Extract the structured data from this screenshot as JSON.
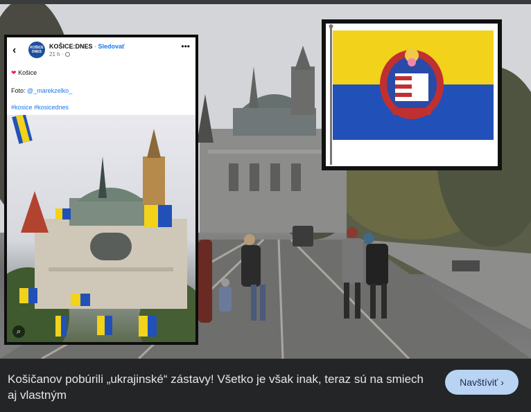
{
  "post": {
    "page_name": "KOŠICE:DNES",
    "separator": "·",
    "follow_label": "Sledovať",
    "time": "21 h ·",
    "avatar_text": "KOŠICE DNES",
    "text_line1": "Košice",
    "text_line2_prefix": "Foto:",
    "text_line2_handle": "@_marekzelko_",
    "hashtags": "#kosice #kosicednes"
  },
  "icons": {
    "back": "chevron-left",
    "more": "more-horizontal",
    "heart": "red-heart",
    "gallery": "gallery-search",
    "visit_chevron": "chevron-right"
  },
  "caption": {
    "headline": "Košičanov pobúrili „ukrajinské“ zástavy! Všetko je však inak, teraz sú na smiech aj vlastným",
    "visit_label": "Navštíviť"
  },
  "colors": {
    "flag_yellow": "#f2d21a",
    "flag_blue": "#2151b8",
    "link_blue": "#1877f2",
    "caption_bg": "#242526",
    "button_bg": "#b9d3f3"
  }
}
